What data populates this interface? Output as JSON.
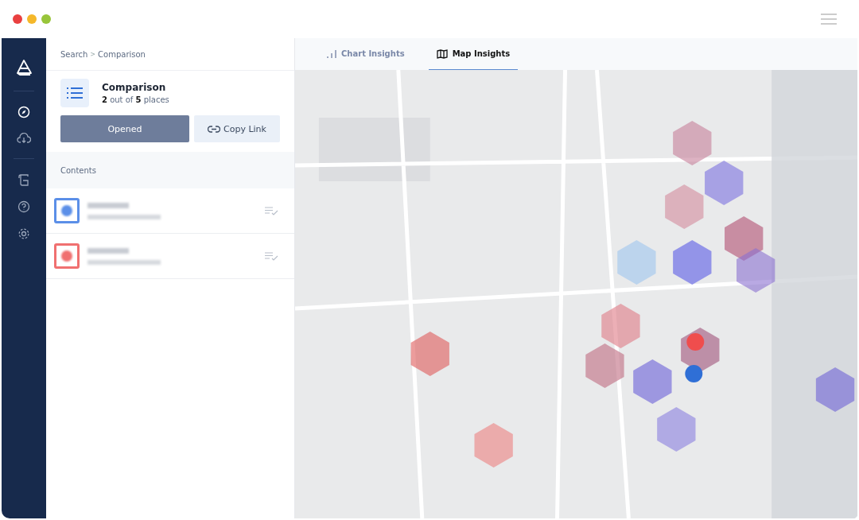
{
  "breadcrumb": {
    "parent": "Search",
    "separator": ">",
    "current": "Comparison"
  },
  "comparison": {
    "title": "Comparison",
    "count_text": "**2** out of **5** places"
  },
  "buttons": [
    {
      "label": "Opened",
      "kind": "primary"
    },
    {
      "label": "Copy Link",
      "kind": "link"
    }
  ],
  "contents": {
    "heading": "Contents",
    "items": [
      {
        "color": "#5b8fe8"
      },
      {
        "color": "#f07070"
      }
    ]
  },
  "tabs": [
    {
      "label": "Chart Insights",
      "kind": "chart",
      "selected": false
    },
    {
      "label": "Map Insights",
      "kind": "map",
      "selected": true
    }
  ]
}
